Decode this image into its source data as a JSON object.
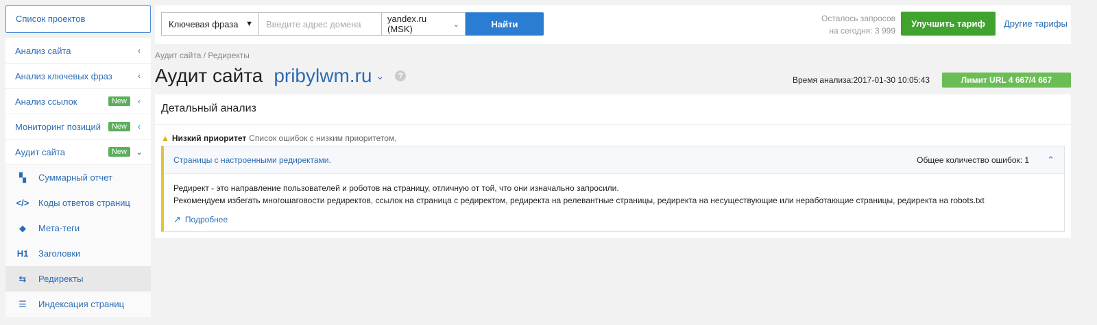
{
  "sidebar": {
    "projects_button": "Список проектов",
    "menu": [
      {
        "label": "Анализ сайта",
        "badge": "",
        "chevron": "‹"
      },
      {
        "label": "Анализ ключевых фраз",
        "badge": "",
        "chevron": "‹"
      },
      {
        "label": "Анализ ссылок",
        "badge": "New",
        "chevron": "‹"
      },
      {
        "label": "Мониторинг позиций",
        "badge": "New",
        "chevron": "‹"
      },
      {
        "label": "Аудит сайта",
        "badge": "New",
        "chevron": "⌄"
      }
    ],
    "submenu": [
      {
        "label": "Суммарный отчет",
        "icon": "summary-icon",
        "glyph": "▚"
      },
      {
        "label": "Коды ответов страниц",
        "icon": "code-icon",
        "glyph": "</>"
      },
      {
        "label": "Мета-теги",
        "icon": "tag-icon",
        "glyph": "◆"
      },
      {
        "label": "Заголовки",
        "icon": "heading-icon",
        "glyph": "H1"
      },
      {
        "label": "Редиректы",
        "icon": "redirect-icon",
        "glyph": "⇆",
        "active": true
      },
      {
        "label": "Индексация страниц",
        "icon": "list-icon",
        "glyph": "☰"
      }
    ]
  },
  "topbar": {
    "keyword_select": "Ключевая фраза",
    "domain_placeholder": "Введите адрес домена",
    "region_select": "yandex.ru (MSK)",
    "find_button": "Найти",
    "quota_line1": "Осталось запросов",
    "quota_line2": "на сегодня: 3 999",
    "upgrade_button": "Улучшить тариф",
    "other_plans": "Другие тарифы"
  },
  "header": {
    "breadcrumb": "Аудит сайта / Редиректы",
    "title": "Аудит сайта",
    "domain": "pribylwm.ru",
    "analysis_time": "Время анализа:2017-01-30 10:05:43",
    "limit": "Лимит URL 4 667/4 667"
  },
  "panel": {
    "title": "Детальный анализ",
    "priority_label": "Низкий приоритет",
    "priority_desc": "Список ошибок с низким приоритетом,",
    "error": {
      "title": "Страницы с настроенными редиректами.",
      "count": "Общее количество ошибок: 1",
      "line1": "Редирект - это направление пользователей и роботов на страницу, отличную от той, что они изначально запросили.",
      "line2": "Рекомендуем избегать многошаговости редиректов, ссылок на страница с редиректом, редиректа на релевантные страницы, редиректа на несуществующие или неработающие страницы, редиректа на robots.txt",
      "more": "Подробнее"
    }
  },
  "colors": {
    "accent": "#2b7dd3",
    "link": "#2a6db5",
    "upgrade": "#3fa32e",
    "limit": "#6bbd55",
    "badge_new": "#5cae5c",
    "warning_bar": "#e3c33b"
  }
}
